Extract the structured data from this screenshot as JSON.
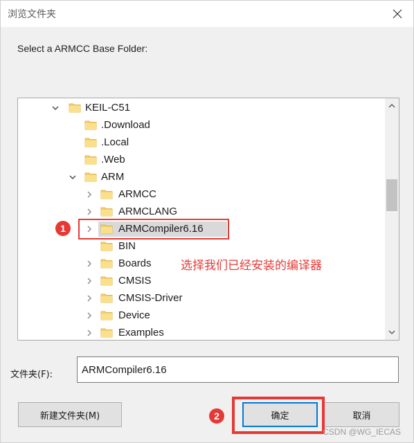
{
  "window": {
    "title": "浏览文件夹"
  },
  "prompt": "Select a ARMCC Base Folder:",
  "tree": {
    "items": [
      {
        "label": "KEIL-C51",
        "expander": "expanded",
        "level": 0
      },
      {
        "label": ".Download",
        "expander": "none",
        "level": 1
      },
      {
        "label": ".Local",
        "expander": "none",
        "level": 1
      },
      {
        "label": ".Web",
        "expander": "none",
        "level": 1
      },
      {
        "label": "ARM",
        "expander": "expanded",
        "level": 1
      },
      {
        "label": "ARMCC",
        "expander": "collapsed",
        "level": 2
      },
      {
        "label": "ARMCLANG",
        "expander": "collapsed",
        "level": 2
      },
      {
        "label": "ARMCompiler6.16",
        "expander": "collapsed",
        "level": 2,
        "selected": true
      },
      {
        "label": "BIN",
        "expander": "none",
        "level": 2
      },
      {
        "label": "Boards",
        "expander": "collapsed",
        "level": 2
      },
      {
        "label": "CMSIS",
        "expander": "collapsed",
        "level": 2
      },
      {
        "label": "CMSIS-Driver",
        "expander": "collapsed",
        "level": 2
      },
      {
        "label": "Device",
        "expander": "collapsed",
        "level": 2
      },
      {
        "label": "Examples",
        "expander": "collapsed",
        "level": 2
      }
    ]
  },
  "folder_field": {
    "label": "文件夹(F):",
    "value": "ARMCompiler6.16"
  },
  "buttons": {
    "new_folder": "新建文件夹(M)",
    "ok": "确定",
    "cancel": "取消"
  },
  "annotations": {
    "marker_1": "1",
    "marker_2": "2",
    "note": "选择我们已经安装的编译器",
    "color": "#e53935"
  },
  "watermark": "CSDN @WG_IECAS",
  "colors": {
    "folder": "#f6d06b",
    "selection": "#d9d9d9",
    "focus_border": "#0078d7"
  }
}
